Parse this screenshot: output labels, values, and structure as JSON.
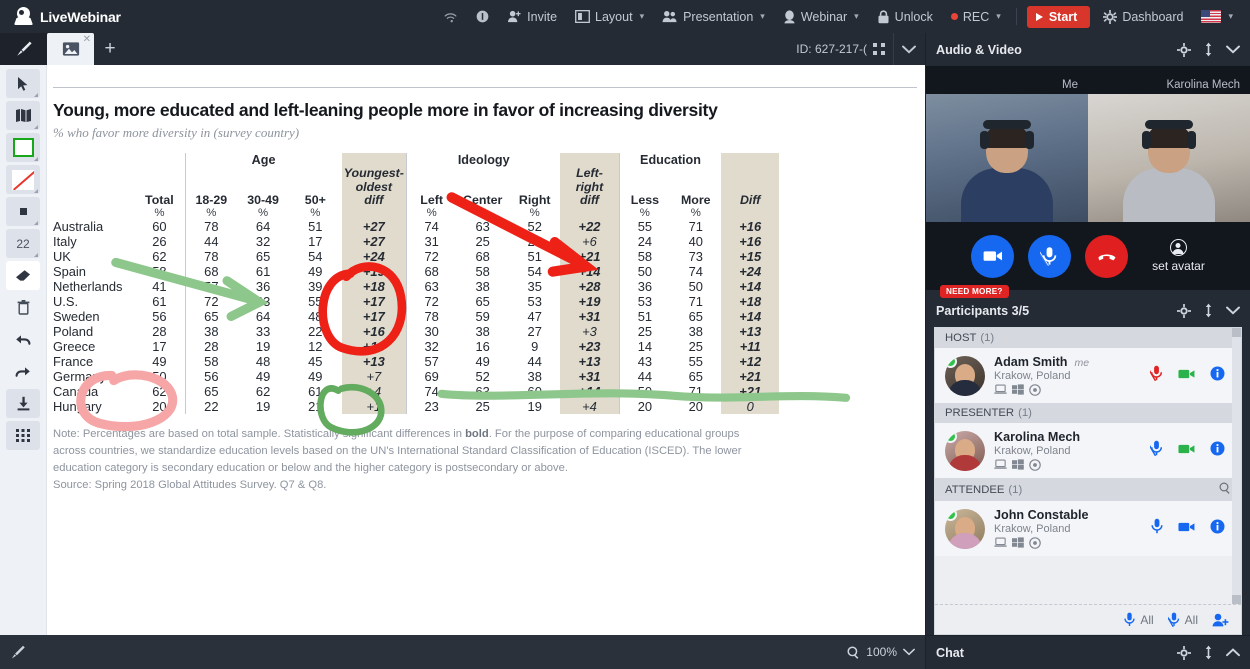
{
  "app": {
    "name": "LiveWebinar",
    "topbar_items": [
      {
        "label": "Invite",
        "icon": "person-add-icon",
        "caret": false
      },
      {
        "label": "Layout",
        "icon": "layout-icon",
        "caret": true
      },
      {
        "label": "Presentation",
        "icon": "presentation-icon",
        "caret": true
      },
      {
        "label": "Webinar",
        "icon": "webinar-icon",
        "caret": true
      },
      {
        "label": "Unlock",
        "icon": "lock-icon",
        "caret": false
      },
      {
        "label": "REC",
        "icon": "record-dot-icon",
        "caret": true
      }
    ],
    "start_button": "Start",
    "dashboard": "Dashboard",
    "language_flag": "us-flag-icon"
  },
  "tabstrip": {
    "brush_tab": "brush-tab",
    "image_tab": "image-tab",
    "add_tab": "+",
    "room_id": "ID: 627-217-(",
    "fullscreen_icon": "expand-icon",
    "chevron": "chevron-down-icon"
  },
  "tools": [
    {
      "name": "cursor-tool",
      "glyph": "arrow"
    },
    {
      "name": "shape-tool",
      "glyph": "shapes"
    },
    {
      "name": "rectangle-tool",
      "glyph": "square-green"
    },
    {
      "name": "line-color-tool",
      "glyph": "diagonal-red"
    },
    {
      "name": "fill-tool",
      "glyph": "dot-square"
    },
    {
      "name": "stroke-width-tool",
      "glyph": "22",
      "value": "22"
    },
    {
      "name": "eraser-tool",
      "glyph": "eraser"
    },
    {
      "name": "delete-tool",
      "glyph": "trash"
    },
    {
      "name": "undo-tool",
      "glyph": "undo"
    },
    {
      "name": "redo-tool",
      "glyph": "redo"
    },
    {
      "name": "download-tool",
      "glyph": "download"
    },
    {
      "name": "grid-tool",
      "glyph": "grid"
    }
  ],
  "canvas_bottom": {
    "pen_label": "",
    "zoom_label": "100%",
    "zoom_icon": "magnifier-icon",
    "chevron": "chevron-down-icon"
  },
  "chart_data": {
    "type": "table",
    "title": "Young, more educated and left-leaning people more in favor of increasing diversity",
    "subtitle": "% who favor more diversity in (survey country)",
    "groups": [
      {
        "label": "",
        "span": 2
      },
      {
        "label": "Age",
        "span": 3
      },
      {
        "label": "",
        "span": 1
      },
      {
        "label": "Ideology",
        "span": 3
      },
      {
        "label": "",
        "span": 1
      },
      {
        "label": "Education",
        "span": 2
      },
      {
        "label": "",
        "span": 1
      }
    ],
    "columns": [
      "",
      "Total",
      "18-29",
      "30-49",
      "50+",
      "Youngest-oldest diff",
      "Left",
      "Center",
      "Right",
      "Left-right diff",
      "Less",
      "More",
      "Diff"
    ],
    "unit_row": [
      "",
      "%",
      "%",
      "%",
      "%",
      "",
      "%",
      "%",
      "%",
      "",
      "%",
      "%",
      ""
    ],
    "rows": [
      {
        "country": "Australia",
        "total": "60",
        "a18_29": "78",
        "a30_49": "64",
        "a50": "51",
        "age_diff": "+27",
        "age_diff_bold": true,
        "left": "74",
        "center": "63",
        "right": "52",
        "ideo_diff": "+22",
        "ideo_diff_bold": true,
        "less": "55",
        "more": "71",
        "edu_diff": "+16",
        "edu_diff_bold": true
      },
      {
        "country": "Italy",
        "total": "26",
        "a18_29": "44",
        "a30_49": "32",
        "a50": "17",
        "age_diff": "+27",
        "age_diff_bold": true,
        "left": "31",
        "center": "25",
        "right": "25",
        "ideo_diff": "+6",
        "ideo_diff_bold": false,
        "less": "24",
        "more": "40",
        "edu_diff": "+16",
        "edu_diff_bold": true
      },
      {
        "country": "UK",
        "total": "62",
        "a18_29": "78",
        "a30_49": "65",
        "a50": "54",
        "age_diff": "+24",
        "age_diff_bold": true,
        "left": "72",
        "center": "68",
        "right": "51",
        "ideo_diff": "+21",
        "ideo_diff_bold": true,
        "less": "58",
        "more": "73",
        "edu_diff": "+15",
        "edu_diff_bold": true
      },
      {
        "country": "Spain",
        "total": "58",
        "a18_29": "68",
        "a30_49": "61",
        "a50": "49",
        "age_diff": "+19",
        "age_diff_bold": true,
        "left": "68",
        "center": "58",
        "right": "54",
        "ideo_diff": "+14",
        "ideo_diff_bold": true,
        "less": "50",
        "more": "74",
        "edu_diff": "+24",
        "edu_diff_bold": true
      },
      {
        "country": "Netherlands",
        "total": "41",
        "a18_29": "57",
        "a30_49": "36",
        "a50": "39",
        "age_diff": "+18",
        "age_diff_bold": true,
        "left": "63",
        "center": "38",
        "right": "35",
        "ideo_diff": "+28",
        "ideo_diff_bold": true,
        "less": "36",
        "more": "50",
        "edu_diff": "+14",
        "edu_diff_bold": true
      },
      {
        "country": "U.S.",
        "total": "61",
        "a18_29": "72",
        "a30_49": "63",
        "a50": "55",
        "age_diff": "+17",
        "age_diff_bold": true,
        "left": "72",
        "center": "65",
        "right": "53",
        "ideo_diff": "+19",
        "ideo_diff_bold": true,
        "less": "53",
        "more": "71",
        "edu_diff": "+18",
        "edu_diff_bold": true
      },
      {
        "country": "Sweden",
        "total": "56",
        "a18_29": "65",
        "a30_49": "64",
        "a50": "48",
        "age_diff": "+17",
        "age_diff_bold": true,
        "left": "78",
        "center": "59",
        "right": "47",
        "ideo_diff": "+31",
        "ideo_diff_bold": true,
        "less": "51",
        "more": "65",
        "edu_diff": "+14",
        "edu_diff_bold": true
      },
      {
        "country": "Poland",
        "total": "28",
        "a18_29": "38",
        "a30_49": "33",
        "a50": "22",
        "age_diff": "+16",
        "age_diff_bold": true,
        "left": "30",
        "center": "38",
        "right": "27",
        "ideo_diff": "+3",
        "ideo_diff_bold": false,
        "less": "25",
        "more": "38",
        "edu_diff": "+13",
        "edu_diff_bold": true
      },
      {
        "country": "Greece",
        "total": "17",
        "a18_29": "28",
        "a30_49": "19",
        "a50": "12",
        "age_diff": "+16",
        "age_diff_bold": true,
        "left": "32",
        "center": "16",
        "right": "9",
        "ideo_diff": "+23",
        "ideo_diff_bold": true,
        "less": "14",
        "more": "25",
        "edu_diff": "+11",
        "edu_diff_bold": true
      },
      {
        "country": "France",
        "total": "49",
        "a18_29": "58",
        "a30_49": "48",
        "a50": "45",
        "age_diff": "+13",
        "age_diff_bold": true,
        "left": "57",
        "center": "49",
        "right": "44",
        "ideo_diff": "+13",
        "ideo_diff_bold": true,
        "less": "43",
        "more": "55",
        "edu_diff": "+12",
        "edu_diff_bold": true
      },
      {
        "country": "Germany",
        "total": "50",
        "a18_29": "56",
        "a30_49": "49",
        "a50": "49",
        "age_diff": "+7",
        "age_diff_bold": false,
        "left": "69",
        "center": "52",
        "right": "38",
        "ideo_diff": "+31",
        "ideo_diff_bold": true,
        "less": "44",
        "more": "65",
        "edu_diff": "+21",
        "edu_diff_bold": true
      },
      {
        "country": "Canada",
        "total": "62",
        "a18_29": "65",
        "a30_49": "62",
        "a50": "61",
        "age_diff": "+4",
        "age_diff_bold": false,
        "left": "74",
        "center": "63",
        "right": "60",
        "ideo_diff": "+14",
        "ideo_diff_bold": true,
        "less": "50",
        "more": "71",
        "edu_diff": "+21",
        "edu_diff_bold": true
      },
      {
        "country": "Hungary",
        "total": "20",
        "a18_29": "22",
        "a30_49": "19",
        "a50": "21",
        "age_diff": "+1",
        "age_diff_bold": false,
        "left": "23",
        "center": "25",
        "right": "19",
        "ideo_diff": "+4",
        "ideo_diff_bold": false,
        "less": "20",
        "more": "20",
        "edu_diff": "0",
        "edu_diff_bold": false
      }
    ],
    "note_line1_a": "Note: Percentages are based on total sample. Statistically significant differences in ",
    "note_bold": "bold",
    "note_line1_b": ". For the purpose of comparing educational groups",
    "note_line2": "across countries, we standardize education levels based on the UN's International Standard Classification of Education (ISCED). The lower",
    "note_line3": "education category is secondary education or below and the higher category is postsecondary or above.",
    "source": "Source: Spring 2018 Global Attitudes Survey. Q7 & Q8.",
    "annotations": [
      {
        "color": "#e8241a",
        "shape": "circle",
        "target": "age_diff column rows Australia–Netherlands"
      },
      {
        "color": "#e8241a",
        "shape": "arrow",
        "target": "ideology left-right diff Australia"
      },
      {
        "color": "#7cbf7c",
        "shape": "arrow",
        "target": "Netherlands total 41"
      },
      {
        "color": "#7cbf7c",
        "shape": "circle",
        "target": "age_diff Poland/Greece +16"
      },
      {
        "color": "#7cbf7c",
        "shape": "line",
        "target": "Poland row across ideology/education"
      },
      {
        "color": "#f2a8a8",
        "shape": "circle",
        "target": "country names Sweden/Poland/Greece"
      }
    ]
  },
  "right_panel": {
    "audio_video": {
      "title": "Audio & Video",
      "gear_icon": "gear-icon",
      "resize_icon": "resize-vertical-icon",
      "collapse_icon": "chevron-down-icon",
      "tiles": [
        {
          "label": "Me"
        },
        {
          "label": "Karolina Mech"
        }
      ],
      "controls": [
        {
          "name": "camera-button",
          "icon": "camera-icon",
          "color": "#1768f0"
        },
        {
          "name": "mic-muted-button",
          "icon": "mic-muted-icon",
          "color": "#1768f0"
        },
        {
          "name": "hangup-button",
          "icon": "phone-hangup-icon",
          "color": "#e02020"
        }
      ],
      "set_avatar": "set avatar",
      "set_avatar_icon": "user-circle-icon"
    },
    "participants": {
      "badge": "NEED MORE?",
      "title": "Participants 3/5",
      "gear_icon": "gear-icon",
      "resize_icon": "resize-vertical-icon",
      "collapse_icon": "chevron-down-icon",
      "groups": [
        {
          "label": "HOST",
          "count": "(1)",
          "search": false,
          "people": [
            {
              "name": "Adam Smith",
              "tag": "me",
              "location": "Krakow, Poland",
              "devices": [
                "laptop-icon",
                "windows-icon",
                "browser-icon"
              ],
              "mic": "mic-muted-icon",
              "mic_color": "#e02424",
              "cam": "camera-icon",
              "cam_color": "#2ab34b",
              "info": "info-icon",
              "info_color": "#1768f0"
            }
          ]
        },
        {
          "label": "PRESENTER",
          "count": "(1)",
          "search": false,
          "people": [
            {
              "name": "Karolina Mech",
              "tag": "",
              "location": "Krakow, Poland",
              "devices": [
                "laptop-icon",
                "windows-icon",
                "browser-icon"
              ],
              "mic": "mic-muted-icon",
              "mic_color": "#1768f0",
              "cam": "camera-icon",
              "cam_color": "#2ab34b",
              "info": "info-icon",
              "info_color": "#1768f0"
            }
          ]
        },
        {
          "label": "ATTENDEE",
          "count": "(1)",
          "search": true,
          "people": [
            {
              "name": "John Constable",
              "tag": "",
              "location": "Krakow, Poland",
              "devices": [
                "laptop-icon",
                "windows-icon",
                "browser-icon"
              ],
              "mic": "mic-icon",
              "mic_color": "#1768f0",
              "cam": "camera-icon",
              "cam_color": "#1768f0",
              "info": "info-icon",
              "info_color": "#1768f0"
            }
          ]
        }
      ],
      "footer": {
        "mic_all": "All",
        "mute_all": "All",
        "add_user_icon": "add-user-icon"
      }
    },
    "chat": {
      "title": "Chat",
      "gear_icon": "gear-icon",
      "resize_icon": "resize-vertical-icon",
      "expand_icon": "chevron-up-icon"
    }
  }
}
